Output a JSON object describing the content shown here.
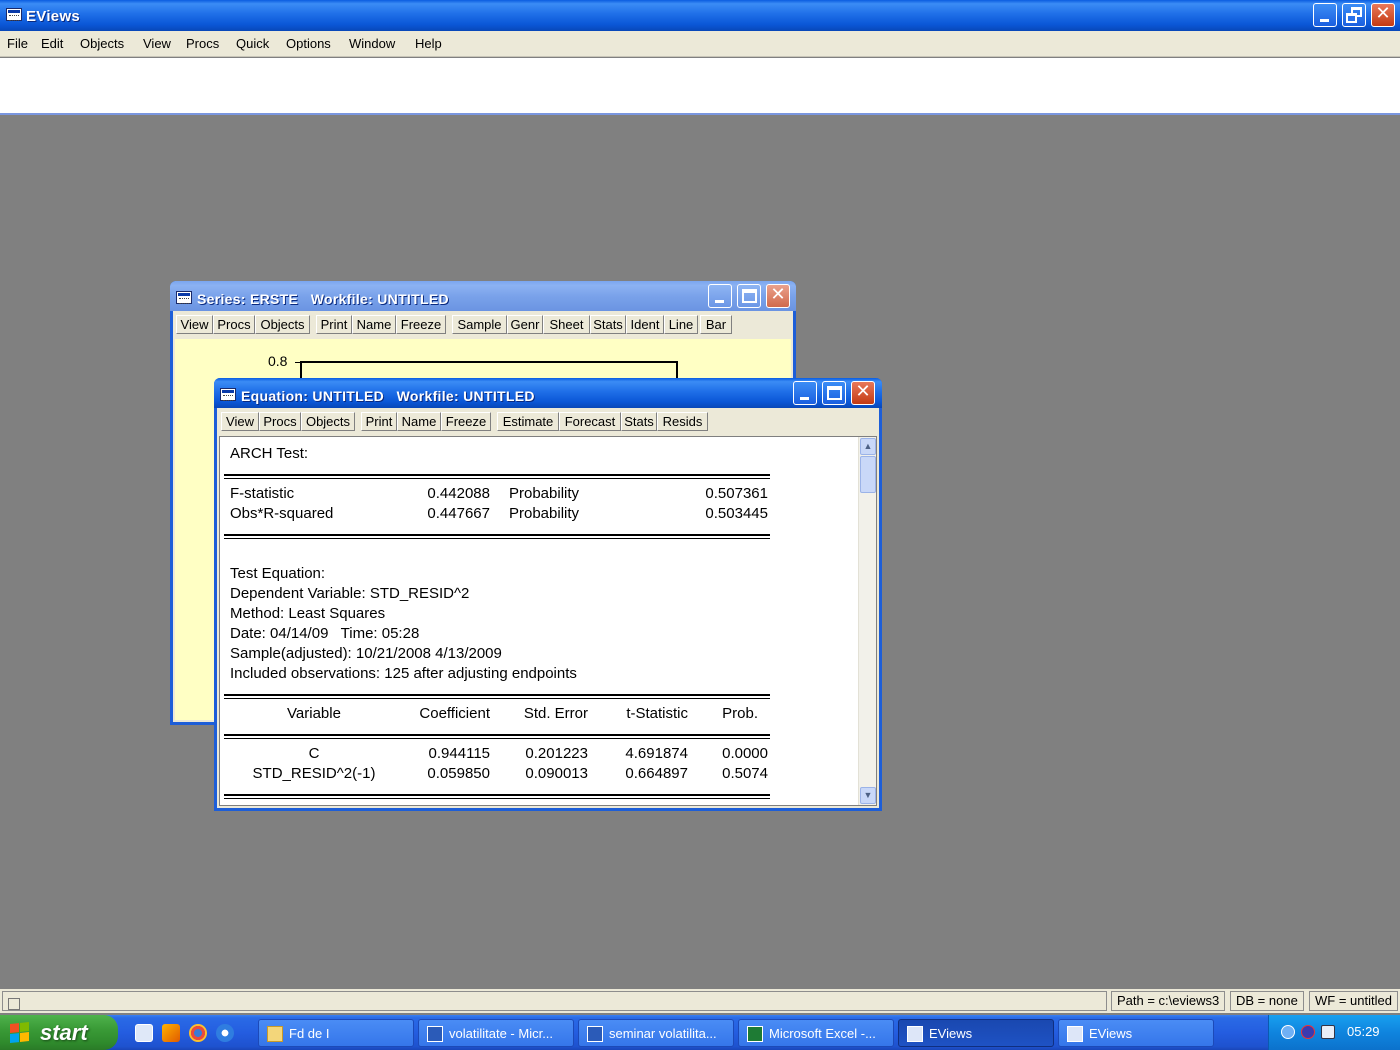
{
  "app": {
    "title": "EViews",
    "menu": [
      "File",
      "Edit",
      "Objects",
      "View",
      "Procs",
      "Quick",
      "Options",
      "Window",
      "Help"
    ]
  },
  "series_window": {
    "title": "Series: ERSTE   Workfile: UNTITLED",
    "toolbar": [
      "View",
      "Procs",
      "Objects",
      "Print",
      "Name",
      "Freeze",
      "Sample",
      "Genr",
      "Sheet",
      "Stats",
      "Ident",
      "Line",
      "Bar"
    ],
    "axis_tick": "0.8"
  },
  "equation_window": {
    "title": "Equation: UNTITLED   Workfile: UNTITLED",
    "toolbar": [
      "View",
      "Procs",
      "Objects",
      "Print",
      "Name",
      "Freeze",
      "Estimate",
      "Forecast",
      "Stats",
      "Resids"
    ],
    "output": {
      "heading": "ARCH Test:",
      "stats": [
        {
          "name": "F-statistic",
          "value": "0.442088",
          "prob_label": "Probability",
          "prob": "0.507361"
        },
        {
          "name": "Obs*R-squared",
          "value": "0.447667",
          "prob_label": "Probability",
          "prob": "0.503445"
        }
      ],
      "info": [
        "Test Equation:",
        "Dependent Variable: STD_RESID^2",
        "Method: Least Squares",
        "Date: 04/14/09   Time: 05:28",
        "Sample(adjusted): 10/21/2008 4/13/2009",
        "Included observations: 125 after adjusting endpoints"
      ],
      "table_headers": [
        "Variable",
        "Coefficient",
        "Std. Error",
        "t-Statistic",
        "Prob."
      ],
      "table_rows": [
        [
          "C",
          "0.944115",
          "0.201223",
          "4.691874",
          "0.0000"
        ],
        [
          "STD_RESID^2(-1)",
          "0.059850",
          "0.090013",
          "0.664897",
          "0.5074"
        ]
      ]
    }
  },
  "statusbar": {
    "path": "Path = c:\\eviews3",
    "db": "DB = none",
    "wf": "WF = untitled"
  },
  "taskbar": {
    "start_label": "start",
    "quick_launch_icons": [
      "show-desktop-icon",
      "media-icon",
      "chrome-like-icon",
      "internet-explorer-icon"
    ],
    "buttons": [
      {
        "label": "Fd de I",
        "icon": "folder-icon"
      },
      {
        "label": "volatilitate - Micr...",
        "icon": "word-icon"
      },
      {
        "label": "seminar volatilita...",
        "icon": "word-icon"
      },
      {
        "label": "Microsoft Excel -...",
        "icon": "excel-icon"
      },
      {
        "label": "EViews",
        "icon": "eviews-icon",
        "active": true
      },
      {
        "label": "EViews",
        "icon": "eviews-icon"
      }
    ],
    "clock": "05:29"
  },
  "colors": {
    "title_blue": "#0a56d6",
    "desktop_gray": "#808080",
    "series_bg": "#ffffc4",
    "start_green": "#3a9b37"
  }
}
